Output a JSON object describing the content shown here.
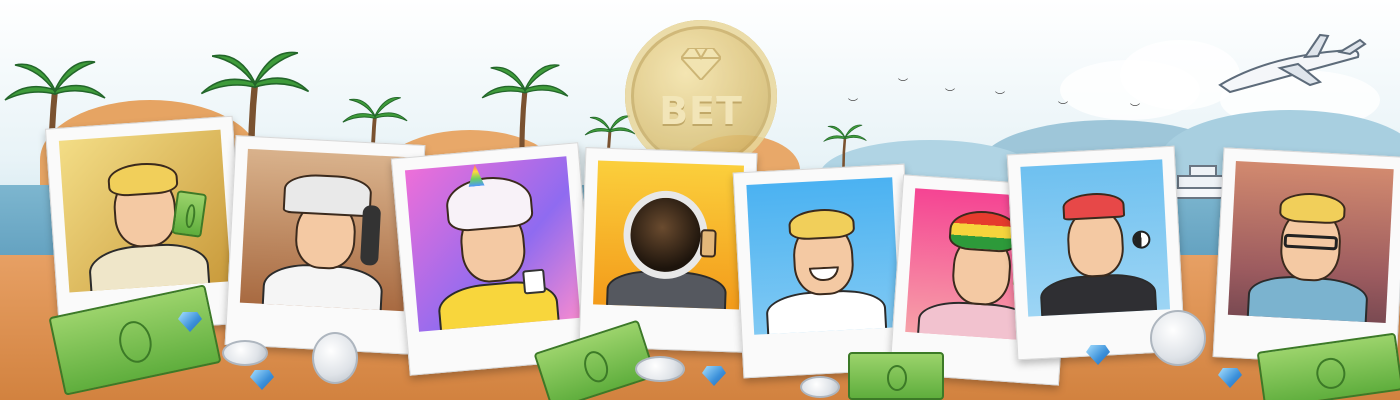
{
  "banner": {
    "coin_brand": "BET",
    "portraits": [
      {
        "name": "money-man",
        "bg": "#e8c860"
      },
      {
        "name": "newspaper-hat-man",
        "bg": "#c98a5a"
      },
      {
        "name": "unicorn-man",
        "bg": "#c86fe0"
      },
      {
        "name": "astronaut-man",
        "bg": "#f6a91d"
      },
      {
        "name": "smiling-man",
        "bg": "#5cb8f0"
      },
      {
        "name": "rasta-man",
        "bg": "#f24f9c"
      },
      {
        "name": "yin-yang-man",
        "bg": "#7ac5f0"
      },
      {
        "name": "glasses-man",
        "bg": "#c47b6a"
      }
    ]
  },
  "colors": {
    "sand": "#d2823f",
    "sea": "#5e9dbd",
    "bill_green": "#5fae3d",
    "coin_gold": "#dcc277"
  }
}
